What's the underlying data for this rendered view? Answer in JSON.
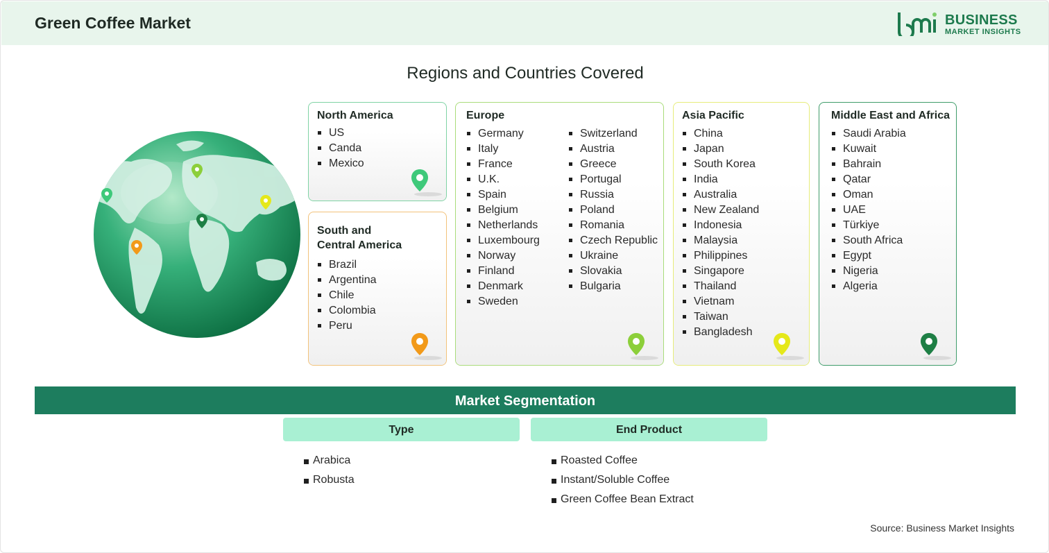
{
  "header": {
    "title": "Green Coffee Market",
    "logo_line1": "BUSINESS",
    "logo_line2": "MARKET INSIGHTS",
    "logo_mark_text": "bmi"
  },
  "section_title": "Regions and Countries Covered",
  "regions": {
    "north_america": {
      "title": "North America",
      "items": [
        "US",
        "Canda",
        "Mexico"
      ],
      "pin_color": "#3ec97a"
    },
    "south_central_america": {
      "title_line1": "South and",
      "title_line2": "Central America",
      "items": [
        "Brazil",
        "Argentina",
        "Chile",
        "Colombia",
        "Peru"
      ],
      "pin_color": "#f29a1a"
    },
    "europe": {
      "title": "Europe",
      "col1": [
        "Germany",
        "Italy",
        "France",
        "U.K.",
        "Spain",
        "Belgium",
        "Netherlands",
        "Luxembourg",
        "Norway",
        "Finland",
        "Denmark",
        "Sweden"
      ],
      "col2": [
        "Switzerland",
        "Austria",
        "Greece",
        "Portugal",
        "Russia",
        "Poland",
        "Romania",
        "Czech Republic",
        "Ukraine",
        "Slovakia",
        "Bulgaria"
      ],
      "pin_color": "#8ccf3a"
    },
    "asia_pacific": {
      "title": "Asia Pacific",
      "items": [
        "China",
        "Japan",
        "South Korea",
        "India",
        "Australia",
        "New Zealand",
        "Indonesia",
        "Malaysia",
        "Philippines",
        "Singapore",
        "Thailand",
        "Vietnam",
        "Taiwan",
        "Bangladesh"
      ],
      "pin_color": "#e5e81a"
    },
    "middle_east_africa": {
      "title": "Middle East and Africa",
      "items": [
        "Saudi Arabia",
        "Kuwait",
        "Bahrain",
        "Qatar",
        "Oman",
        "UAE",
        "Türkiye",
        "South Africa",
        "Egypt",
        "Nigeria",
        "Algeria"
      ],
      "pin_color": "#1e7f45"
    }
  },
  "segmentation": {
    "title": "Market Segmentation",
    "type": {
      "header": "Type",
      "items": [
        "Arabica",
        "Robusta"
      ]
    },
    "end_product": {
      "header": "End Product",
      "items": [
        "Roasted Coffee",
        "Instant/Soluble Coffee",
        "Green Coffee Bean Extract"
      ]
    }
  },
  "source": "Source: Business Market Insights",
  "colors": {
    "brand": "#1d7a4d",
    "segment_bar": "#1d7d5e",
    "segment_head": "#a9f0d3",
    "header_bg": "#e8f5ec"
  },
  "icons": [
    "globe-icon",
    "location-pin-icon",
    "bmi-logo-icon"
  ]
}
